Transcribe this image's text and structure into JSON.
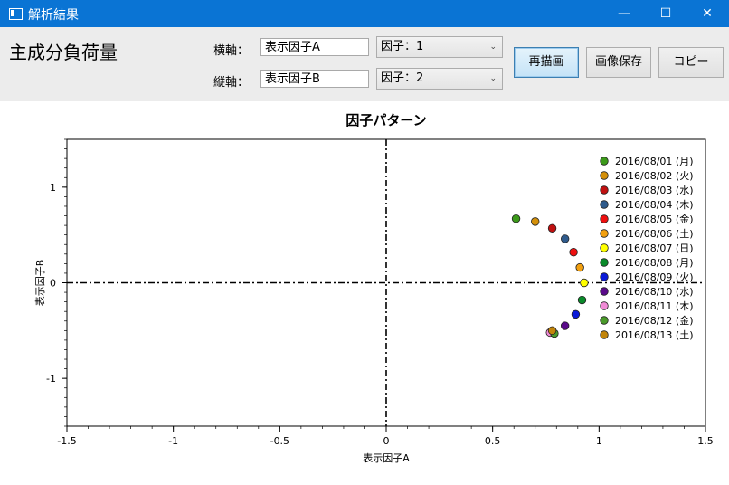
{
  "window": {
    "title": "解析結果",
    "minimize_icon": "minimize-icon",
    "maximize_icon": "maximize-icon",
    "close_icon": "close-icon"
  },
  "toolbar": {
    "heading": "主成分負荷量",
    "x_axis": {
      "label": "横軸：",
      "name_value": "表示因子A",
      "factor_value": "因子：1"
    },
    "y_axis": {
      "label": "縦軸：",
      "name_value": "表示因子B",
      "factor_value": "因子：2"
    },
    "redraw_label": "再描画",
    "save_image_label": "画像保存",
    "copy_label": "コピー"
  },
  "chart_data": {
    "type": "scatter",
    "title": "因子パターン",
    "xlabel": "表示因子A",
    "ylabel": "表示因子B",
    "xlim": [
      -1.5,
      1.5
    ],
    "ylim": [
      -1.5,
      1.5
    ],
    "xticks": [
      "-1.5",
      "-1",
      "-0.5",
      "0",
      "0.5",
      "1",
      "1.5"
    ],
    "yticks": [
      "-1",
      "0",
      "1"
    ],
    "legend_position": "top-right",
    "series": [
      {
        "name": "2016/08/01 (月)",
        "color": "#3c9a1a",
        "x": 0.61,
        "y": 0.67
      },
      {
        "name": "2016/08/02 (火)",
        "color": "#d4900a",
        "x": 0.7,
        "y": 0.64
      },
      {
        "name": "2016/08/03 (水)",
        "color": "#c01010",
        "x": 0.78,
        "y": 0.57
      },
      {
        "name": "2016/08/04 (木)",
        "color": "#2f5b8c",
        "x": 0.84,
        "y": 0.46
      },
      {
        "name": "2016/08/05 (金)",
        "color": "#ee1010",
        "x": 0.88,
        "y": 0.32
      },
      {
        "name": "2016/08/06 (土)",
        "color": "#f2a010",
        "x": 0.91,
        "y": 0.16
      },
      {
        "name": "2016/08/07 (日)",
        "color": "#ffff00",
        "x": 0.93,
        "y": 0.0
      },
      {
        "name": "2016/08/08 (月)",
        "color": "#0a8a2a",
        "x": 0.92,
        "y": -0.18
      },
      {
        "name": "2016/08/09 (火)",
        "color": "#0a1ad8",
        "x": 0.89,
        "y": -0.33
      },
      {
        "name": "2016/08/10 (水)",
        "color": "#5a0a8a",
        "x": 0.84,
        "y": -0.45
      },
      {
        "name": "2016/08/11 (木)",
        "color": "#f08ad6",
        "x": 0.77,
        "y": -0.52
      },
      {
        "name": "2016/08/12 (金)",
        "color": "#4a9a2a",
        "x": 0.79,
        "y": -0.53
      },
      {
        "name": "2016/08/13 (土)",
        "color": "#c2850a",
        "x": 0.78,
        "y": -0.5
      }
    ]
  }
}
